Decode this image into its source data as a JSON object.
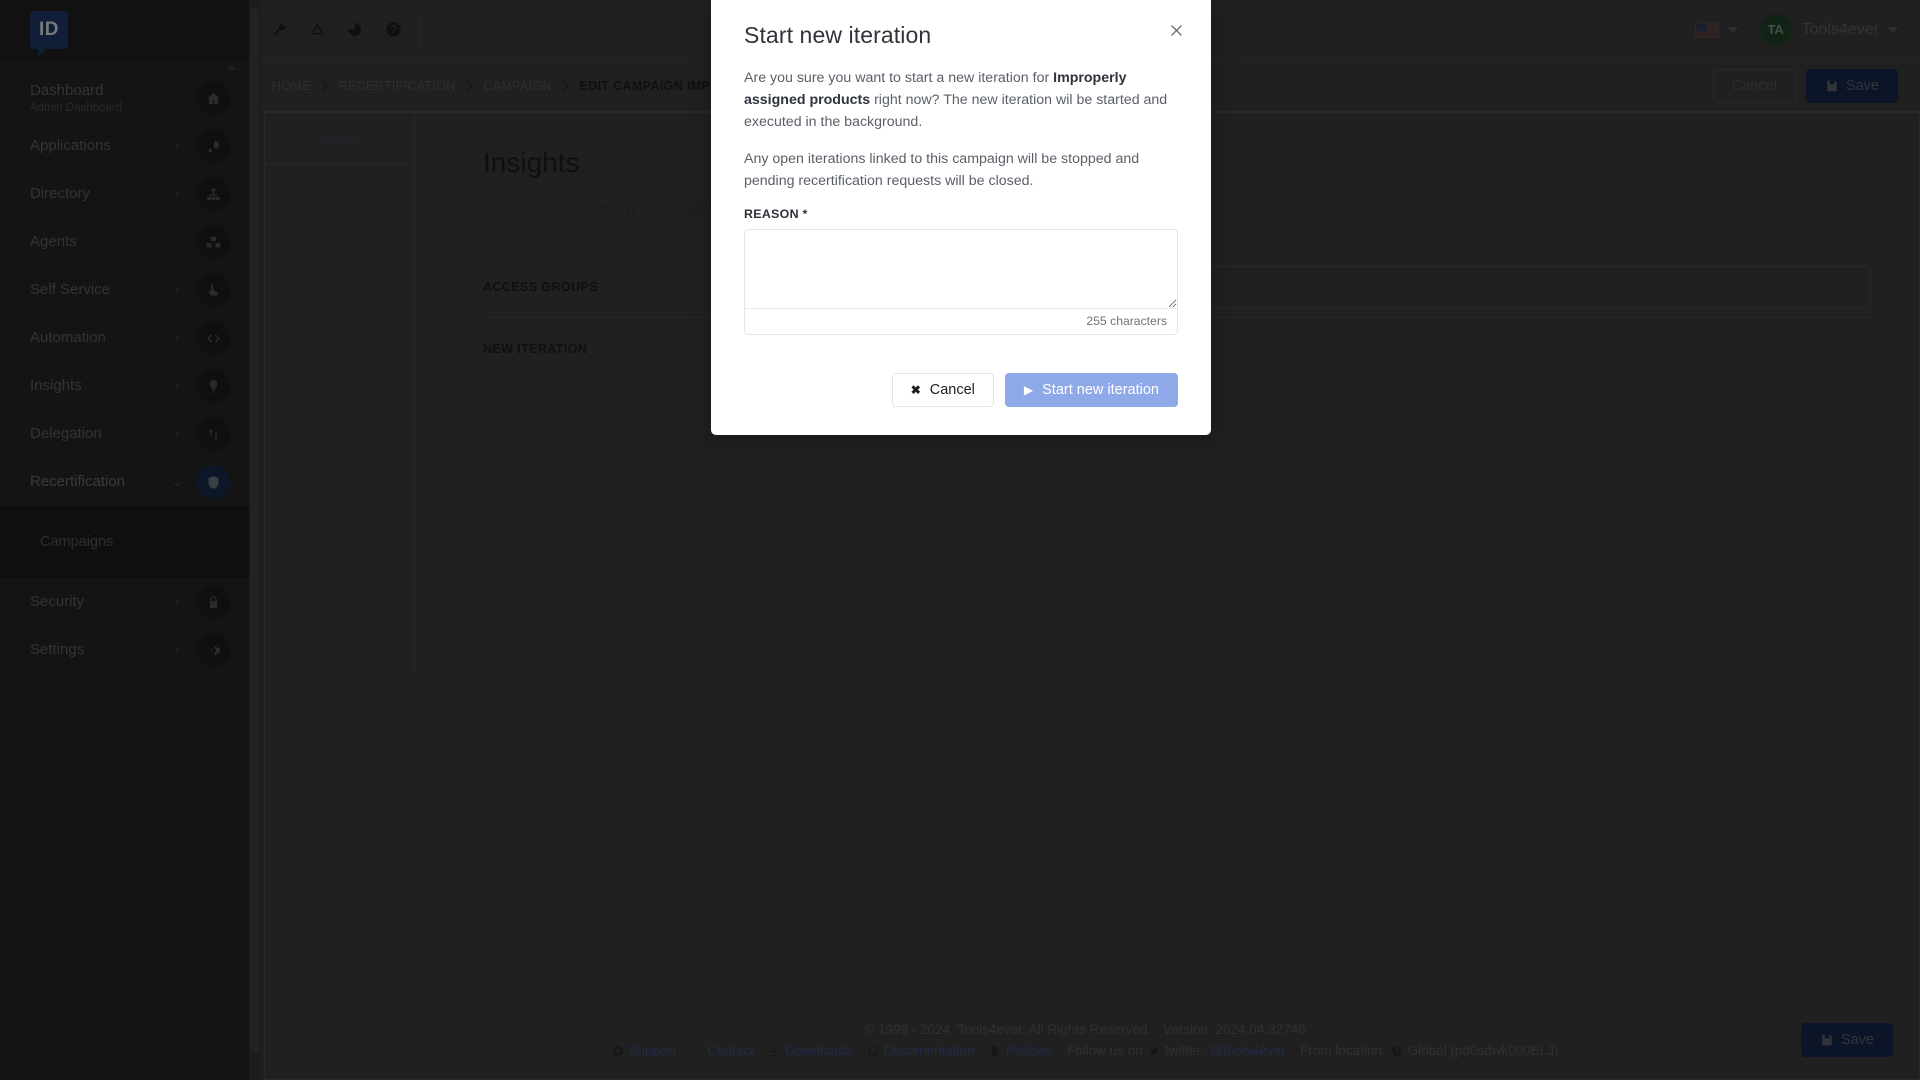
{
  "sidebar": {
    "logo_text": "ID",
    "items": [
      {
        "label": "Dashboard",
        "sublabel": "Admin Dashboard",
        "icon": "home-icon",
        "caret": "",
        "active": false
      },
      {
        "label": "Applications",
        "sublabel": "",
        "icon": "rocket-icon",
        "caret": "‹",
        "active": false
      },
      {
        "label": "Directory",
        "sublabel": "",
        "icon": "sitemap-icon",
        "caret": "‹",
        "active": false
      },
      {
        "label": "Agents",
        "sublabel": "",
        "icon": "cubes-icon",
        "caret": "",
        "active": false
      },
      {
        "label": "Self Service",
        "sublabel": "",
        "icon": "hand-pointer-icon",
        "caret": "‹",
        "active": false
      },
      {
        "label": "Automation",
        "sublabel": "",
        "icon": "code-icon",
        "caret": "‹",
        "active": false
      },
      {
        "label": "Insights",
        "sublabel": "",
        "icon": "lightbulb-icon",
        "caret": "‹",
        "active": false
      },
      {
        "label": "Delegation",
        "sublabel": "",
        "icon": "arrows-updown-icon",
        "caret": "‹",
        "active": false
      },
      {
        "label": "Recertification",
        "sublabel": "",
        "icon": "shield-icon",
        "caret": "⌄",
        "active": true
      }
    ],
    "sub_item": "Campaigns",
    "items_after": [
      {
        "label": "Security",
        "sublabel": "",
        "icon": "lock-icon",
        "caret": "‹",
        "active": false
      },
      {
        "label": "Settings",
        "sublabel": "",
        "icon": "gear-icon",
        "caret": "‹",
        "active": false
      }
    ]
  },
  "topbar": {
    "tools": [
      "wrench-icon",
      "triangle-ruler-icon",
      "pie-chart-icon",
      "question-circle-icon"
    ],
    "language_flag": "us-flag-icon",
    "avatar_initials": "TA",
    "user_name": "Tools4ever"
  },
  "subheader": {
    "breadcrumb": [
      "HOME",
      "RECERTIFICATION",
      "CAMPAIGN",
      "EDIT CAMPAIGN IMPROPERLY ASSIGNED PRODUCTS"
    ],
    "cancel_label": "Cancel",
    "save_label": "Save"
  },
  "content": {
    "tab_label": "Insight",
    "panel_title": "Insights",
    "panel_desc": "Only members of the groups listed below will have access to this insight on their dashboard",
    "rows": [
      {
        "label": "ACCESS GROUPS",
        "control": "tag-input"
      },
      {
        "label": "NEW ITERATION",
        "control": "start-button"
      }
    ],
    "bottom_save_label": "Save"
  },
  "footer": {
    "copyright": "© 1999 - 2024. Tools4ever. All Rights Reserved. · Version: 2024.04.32746",
    "links": [
      {
        "icon": "lifering-icon",
        "label": "Support"
      },
      {
        "icon": "info-icon",
        "label": "Contact"
      },
      {
        "icon": "download-icon",
        "label": "Downloads"
      },
      {
        "icon": "book-icon",
        "label": "Documentation"
      },
      {
        "icon": "file-icon",
        "label": "Policies"
      }
    ],
    "follow_text": "Follow us on",
    "twitter_icon": "twitter-icon",
    "twitter_label": "twitter:",
    "twitter_handle": "@tools4ever",
    "location_text": "From location:",
    "globe_icon": "globe-icon",
    "location_value": "Global (pd0sdwk000ELJ)"
  },
  "modal": {
    "title": "Start new iteration",
    "close_icon": "close-icon",
    "paragraph_1_pre": "Are you sure you want to start a new iteration for ",
    "paragraph_1_bold": "Improperly assigned products",
    "paragraph_1_post": " right now? The new iteration wil be started and executed in the background.",
    "paragraph_2": "Any open iterations linked to this campaign will be stopped and pending recertification requests will be closed.",
    "reason_label": "REASON *",
    "reason_value": "",
    "reason_placeholder": "",
    "char_counter": "255 characters",
    "cancel_label": "Cancel",
    "confirm_label": "Start new iteration",
    "confirm_color": "#8fa8e8"
  }
}
